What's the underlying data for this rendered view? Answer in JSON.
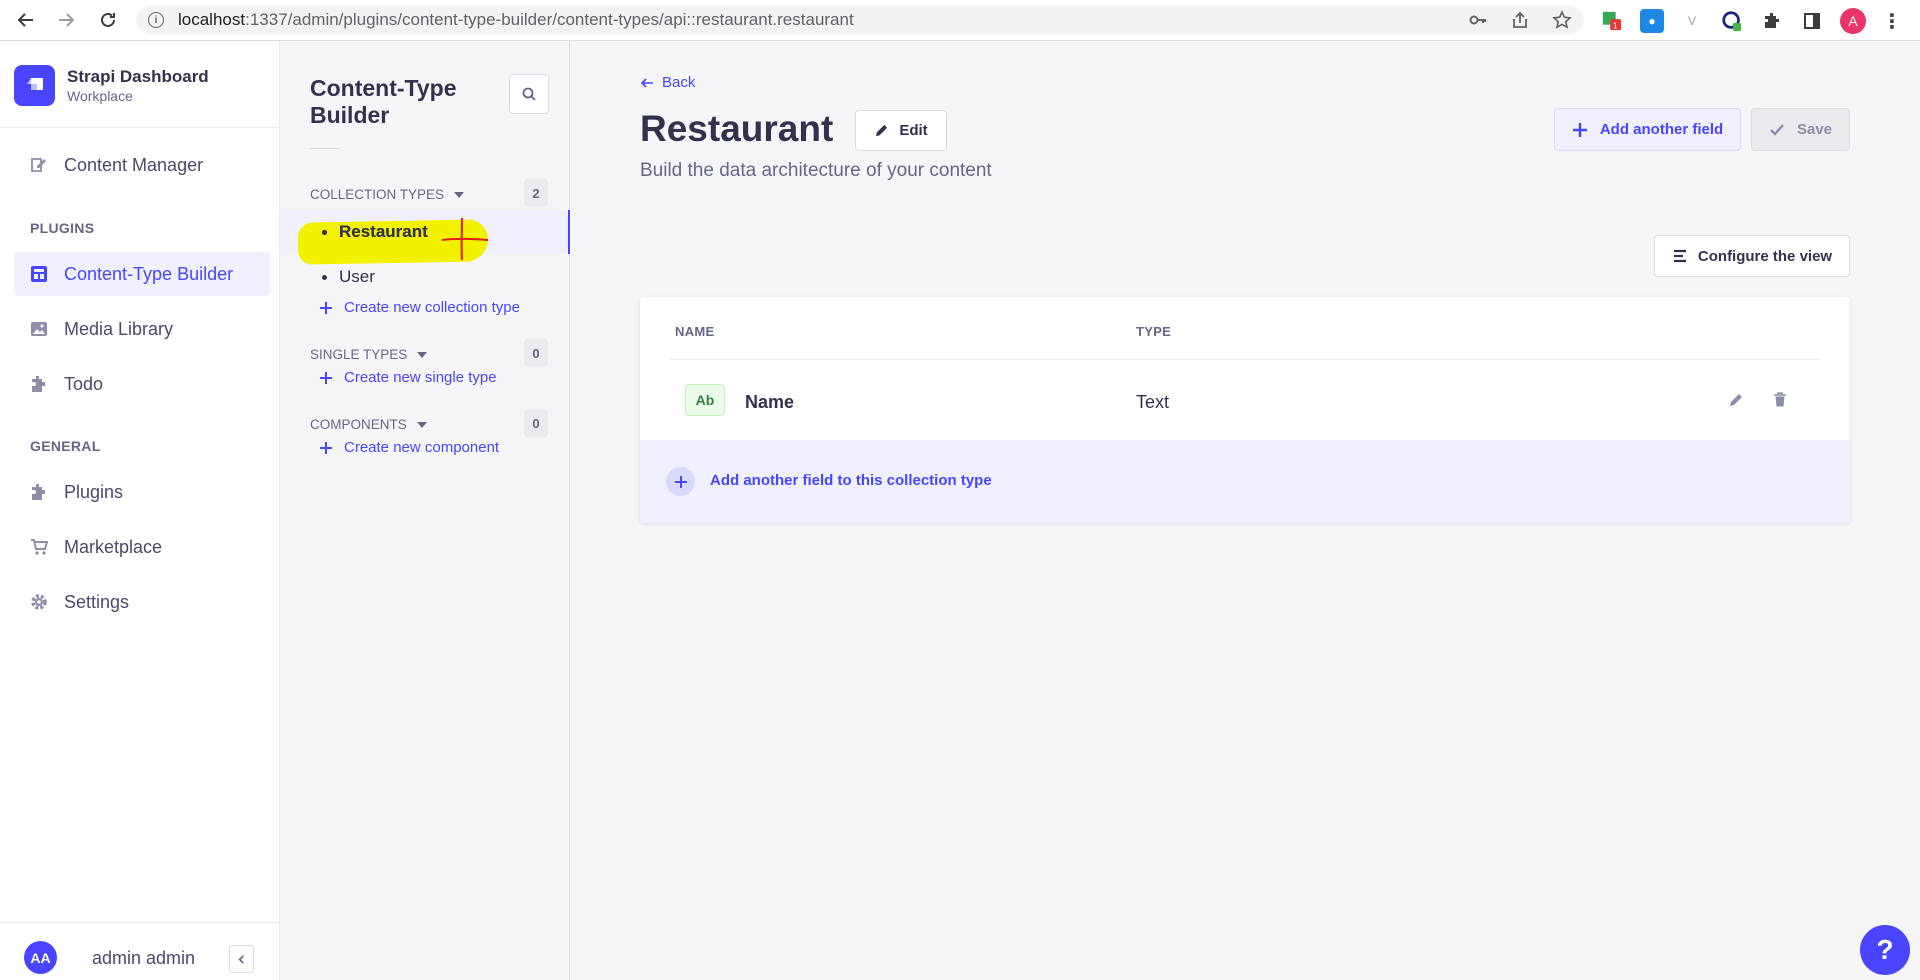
{
  "browser": {
    "url_host": "localhost",
    "url_path": ":1337/admin/plugins/content-type-builder/content-types/api::restaurant.restaurant",
    "profile_initial": "A"
  },
  "brand": {
    "title": "Strapi Dashboard",
    "subtitle": "Workplace"
  },
  "main_nav": {
    "content_manager": "Content Manager",
    "plugins_section": "PLUGINS",
    "content_type_builder": "Content-Type Builder",
    "media_library": "Media Library",
    "todo": "Todo",
    "general_section": "GENERAL",
    "plugins": "Plugins",
    "marketplace": "Marketplace",
    "settings": "Settings",
    "user_initials": "AA",
    "user_name": "admin admin"
  },
  "sub_nav": {
    "title": "Content-Type Builder",
    "collection_types": {
      "label": "COLLECTION TYPES",
      "count": "2",
      "items": [
        "Restaurant",
        "User"
      ],
      "create_label": "Create new collection type"
    },
    "single_types": {
      "label": "SINGLE TYPES",
      "count": "0",
      "create_label": "Create new single type"
    },
    "components": {
      "label": "COMPONENTS",
      "count": "0",
      "create_label": "Create new component"
    }
  },
  "main": {
    "back_label": "Back",
    "title": "Restaurant",
    "edit_label": "Edit",
    "subtitle": "Build the data architecture of your content",
    "add_field_label": "Add another field",
    "save_label": "Save",
    "configure_label": "Configure the view",
    "table": {
      "col_name": "NAME",
      "col_type": "TYPE",
      "rows": [
        {
          "badge": "Ab",
          "name": "Name",
          "type": "Text"
        }
      ],
      "add_row_label": "Add another field to this collection type"
    }
  },
  "help_label": "?",
  "colors": {
    "accent": "#4945ff",
    "highlight": "#f2f200",
    "annotation": "#e21b1b"
  }
}
